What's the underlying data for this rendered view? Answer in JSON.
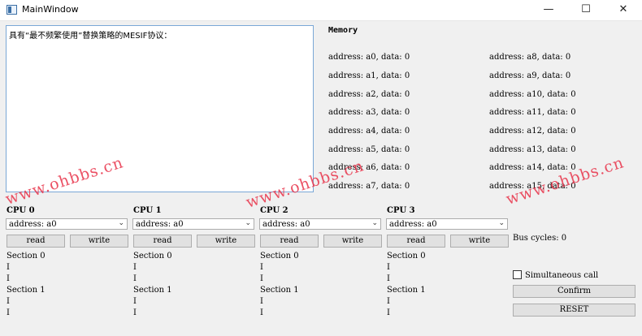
{
  "window": {
    "title": "MainWindow",
    "minimize": "—",
    "maximize": "☐",
    "close": "✕"
  },
  "textarea": {
    "value": "具有“最不频繁使用”替换策略的MESIF协议："
  },
  "memory": {
    "title": "Memory",
    "entries": [
      "address: a0, data: 0",
      "address: a1, data: 0",
      "address: a2, data: 0",
      "address: a3, data: 0",
      "address: a4, data: 0",
      "address: a5, data: 0",
      "address: a6, data: 0",
      "address: a7, data: 0",
      "address: a8, data: 0",
      "address: a9, data: 0",
      "address: a10, data: 0",
      "address: a11, data: 0",
      "address: a12, data: 0",
      "address: a13, data: 0",
      "address: a14, data: 0",
      "address: a15, data: 0"
    ]
  },
  "cpus": [
    {
      "title": "CPU 0",
      "address": "address: a0",
      "read": "read",
      "write": "write",
      "section0": "Section 0",
      "s0_line1": "I",
      "s0_line2": "I",
      "section1": "Section 1",
      "s1_line1": "I",
      "s1_line2": "I"
    },
    {
      "title": "CPU 1",
      "address": "address: a0",
      "read": "read",
      "write": "write",
      "section0": "Section 0",
      "s0_line1": "I",
      "s0_line2": "I",
      "section1": "Section 1",
      "s1_line1": "I",
      "s1_line2": "I"
    },
    {
      "title": "CPU 2",
      "address": "address: a0",
      "read": "read",
      "write": "write",
      "section0": "Section 0",
      "s0_line1": "I",
      "s0_line2": "I",
      "section1": "Section 1",
      "s1_line1": "I",
      "s1_line2": "I"
    },
    {
      "title": "CPU 3",
      "address": "address: a0",
      "read": "read",
      "write": "write",
      "section0": "Section 0",
      "s0_line1": "I",
      "s0_line2": "I",
      "section1": "Section 1",
      "s1_line1": "I",
      "s1_line2": "I"
    }
  ],
  "controls": {
    "bus_cycles": "Bus cycles: 0",
    "simultaneous": "Simultaneous call",
    "simultaneous_checked": false,
    "confirm": "Confirm",
    "reset": "RESET"
  },
  "watermark": "www.ohbbs.cn"
}
